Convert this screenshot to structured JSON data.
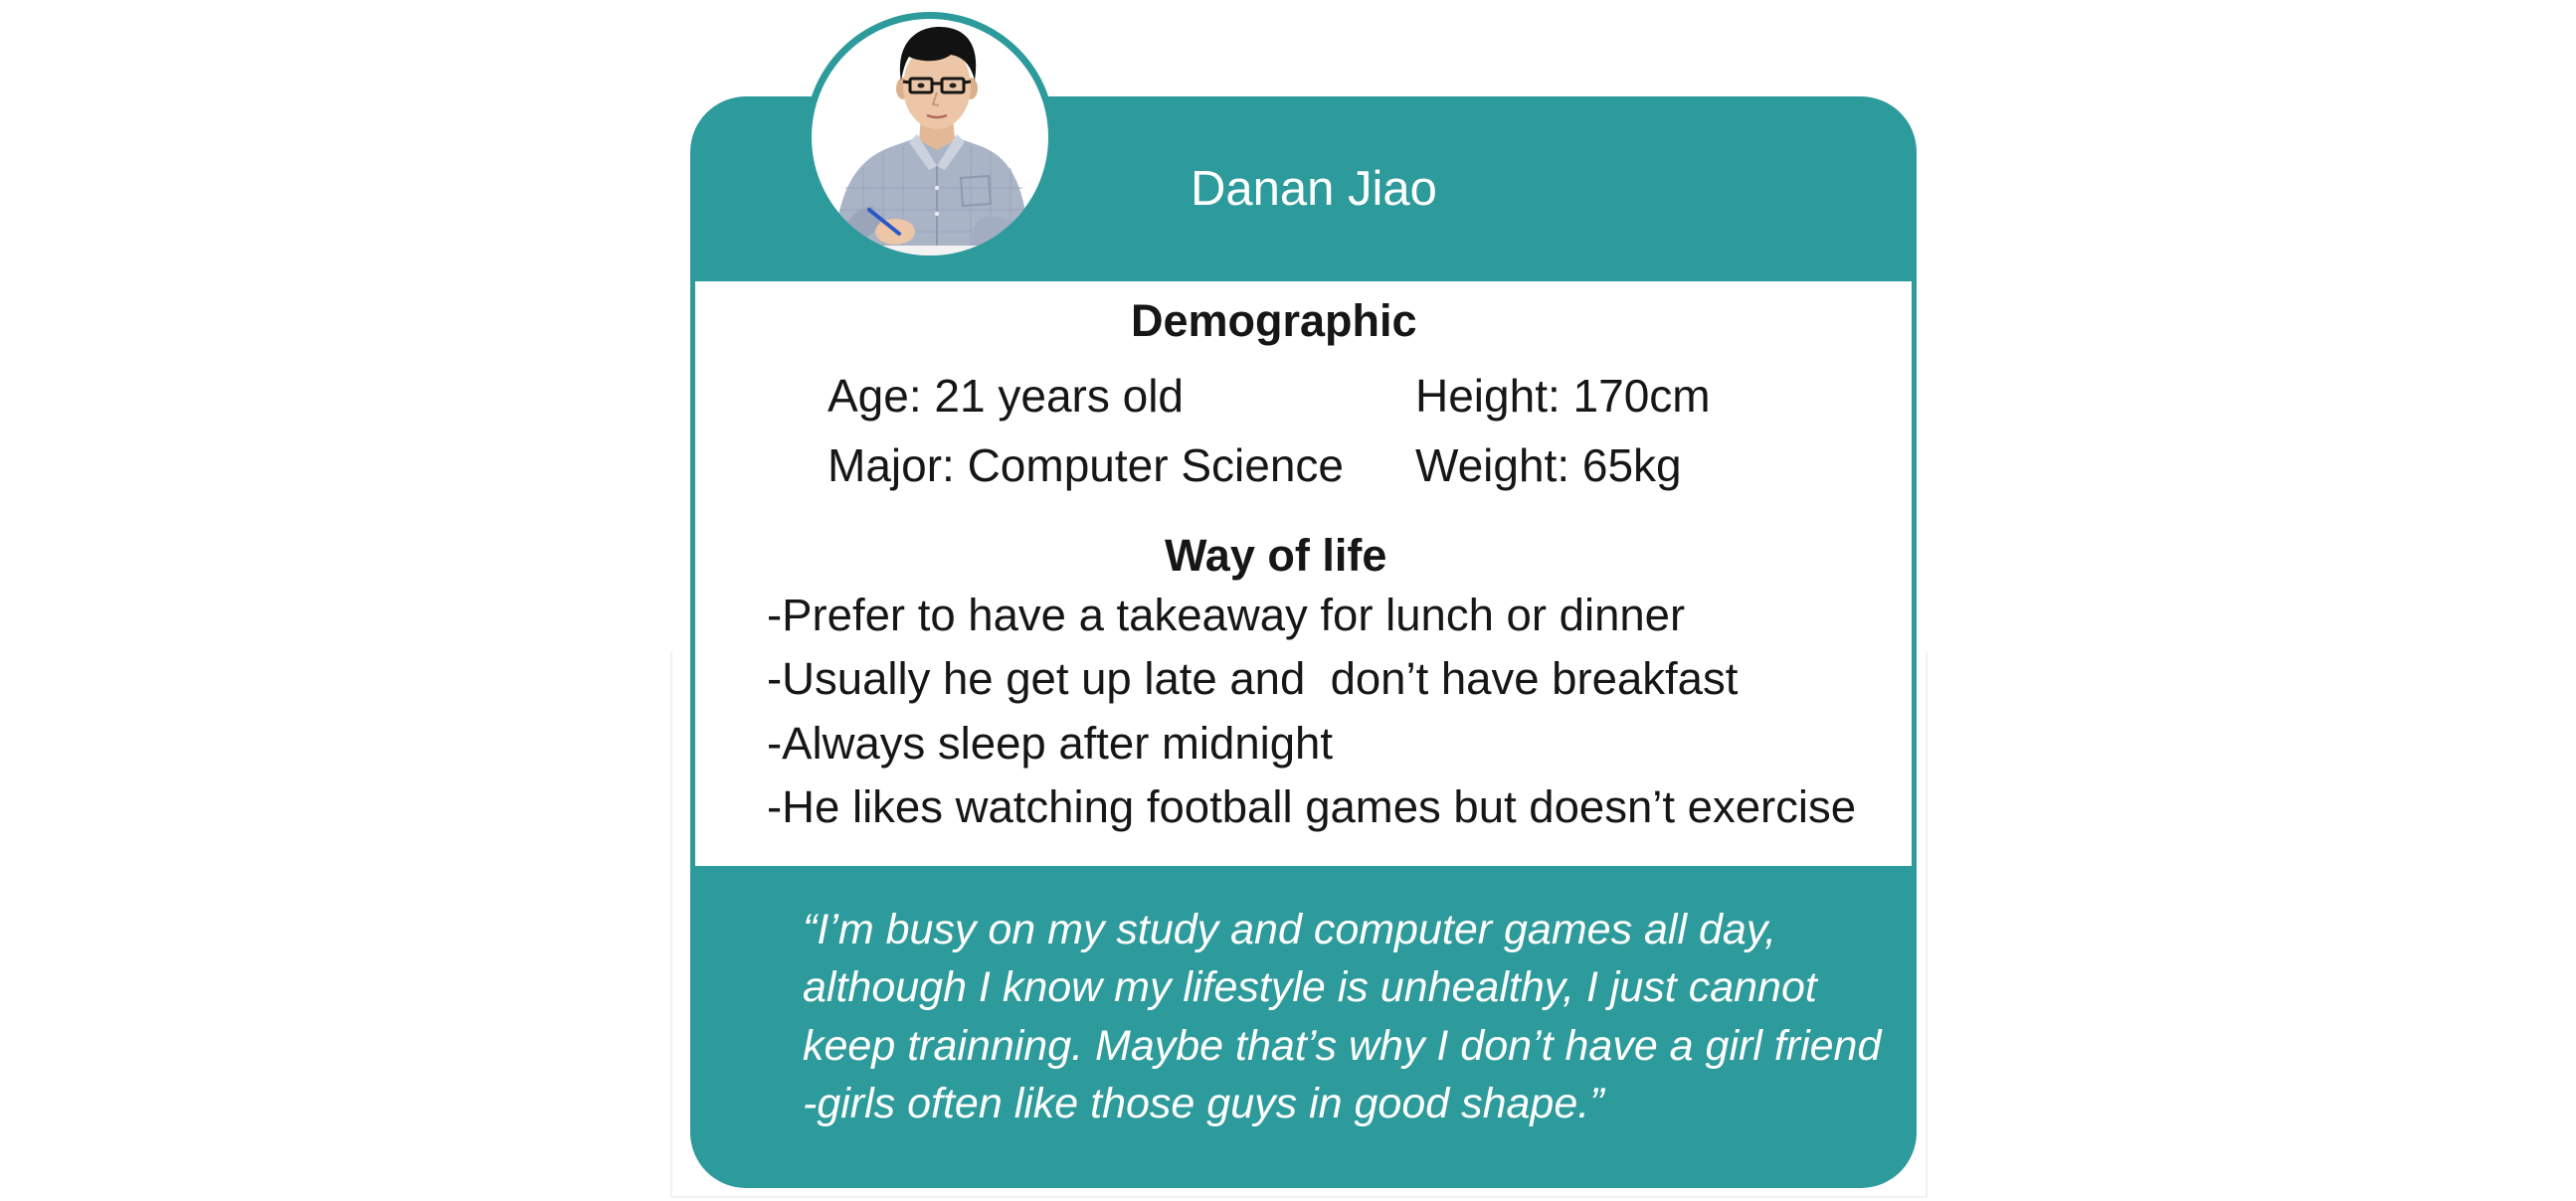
{
  "persona": {
    "name": "Danan Jiao",
    "avatar_icon": "person-photo"
  },
  "demographic": {
    "title": "Demographic",
    "age": "Age: 21 years old",
    "height": "Height: 170cm",
    "major": "Major: Computer Science",
    "weight": "Weight: 65kg"
  },
  "way_of_life": {
    "title": "Way of life",
    "items": [
      "-Prefer to have a takeaway for lunch or dinner",
      "-Usually he get up late and  don’t have breakfast",
      "-Always sleep after midnight",
      "-He likes watching football games but doesn’t exercise"
    ]
  },
  "quote": {
    "lines": [
      "“I’m busy on my study and computer games all day,",
      "although I know my lifestyle is unhealthy, I just cannot",
      "keep trainning. Maybe that’s why I don’t have a girl friend",
      "-girls often like those guys in good shape.”"
    ]
  },
  "colors": {
    "teal": "#2d9a9b",
    "panel": "#ffffff",
    "ink": "#161616",
    "on_teal": "#ffffff"
  }
}
